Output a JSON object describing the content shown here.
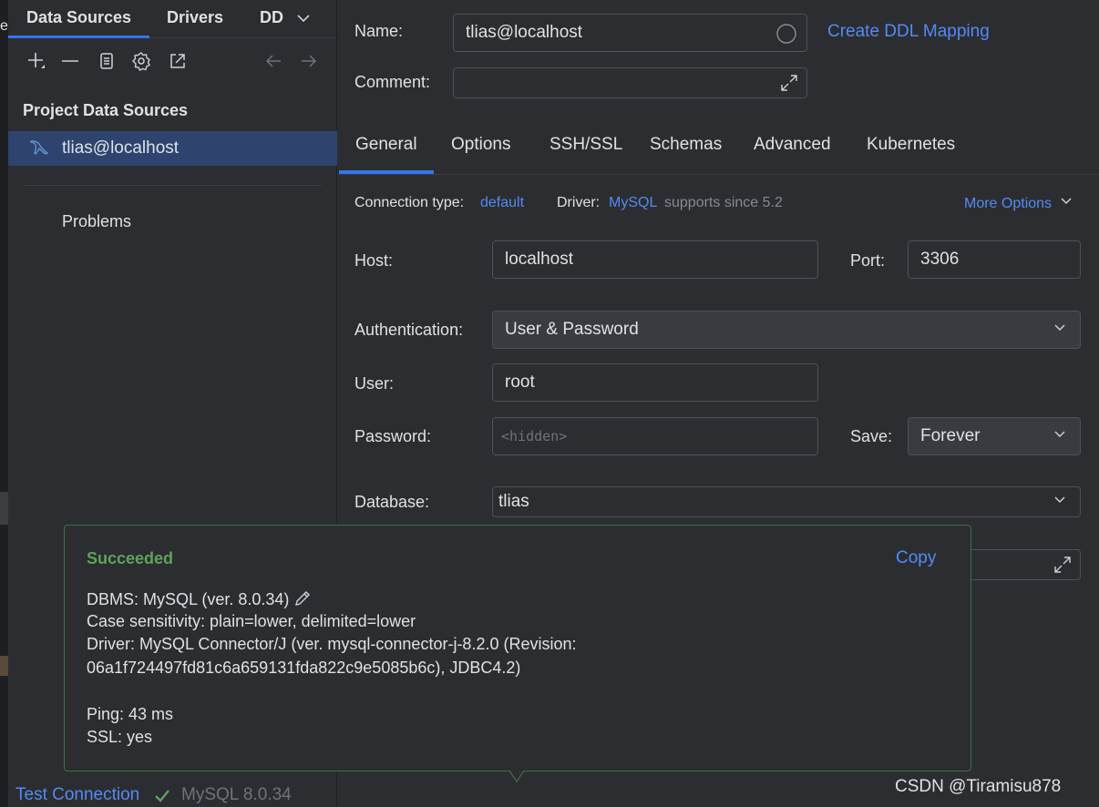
{
  "edge": {
    "char": "e"
  },
  "left": {
    "tabs": [
      "Data Sources",
      "Drivers",
      "DD"
    ],
    "section_title": "Project Data Sources",
    "datasource": "tlias@localhost",
    "problems": "Problems"
  },
  "form": {
    "name_label": "Name:",
    "name_value": "tlias@localhost",
    "create_ddl": "Create DDL Mapping",
    "comment_label": "Comment:",
    "comment_value": "",
    "tabs": [
      "General",
      "Options",
      "SSH/SSL",
      "Schemas",
      "Advanced",
      "Kubernetes"
    ],
    "active_tab": "General",
    "conn_type_label": "Connection type:",
    "conn_type_value": "default",
    "driver_label": "Driver:",
    "driver_value": "MySQL",
    "driver_note": "supports since 5.2",
    "more_options": "More Options",
    "host_label": "Host:",
    "host_value": "localhost",
    "port_label": "Port:",
    "port_value": "3306",
    "auth_label": "Authentication:",
    "auth_value": "User & Password",
    "user_label": "User:",
    "user_value": "root",
    "password_label": "Password:",
    "password_placeholder": "<hidden>",
    "save_label": "Save:",
    "save_value": "Forever",
    "database_label": "Database:",
    "database_value": "tlias"
  },
  "popup": {
    "status": "Succeeded",
    "copy": "Copy",
    "dbms": "DBMS: MySQL (ver. 8.0.34)",
    "case": "Case sensitivity: plain=lower, delimited=lower",
    "driver_line1": "Driver: MySQL Connector/J (ver. mysql-connector-j-8.2.0 (Revision:",
    "driver_line2": "06a1f724497fd81c6a659131fda822c9e5085b6c), JDBC4.2)",
    "ping": "Ping: 43 ms",
    "ssl": "SSL: yes"
  },
  "bottom": {
    "test_connection": "Test Connection",
    "mysql_version": "MySQL 8.0.34",
    "watermark": "CSDN @Tiramisu878"
  },
  "colors": {
    "accent": "#3574f0",
    "link": "#548af7",
    "success": "#5fa25c",
    "selection": "#2e436e"
  }
}
